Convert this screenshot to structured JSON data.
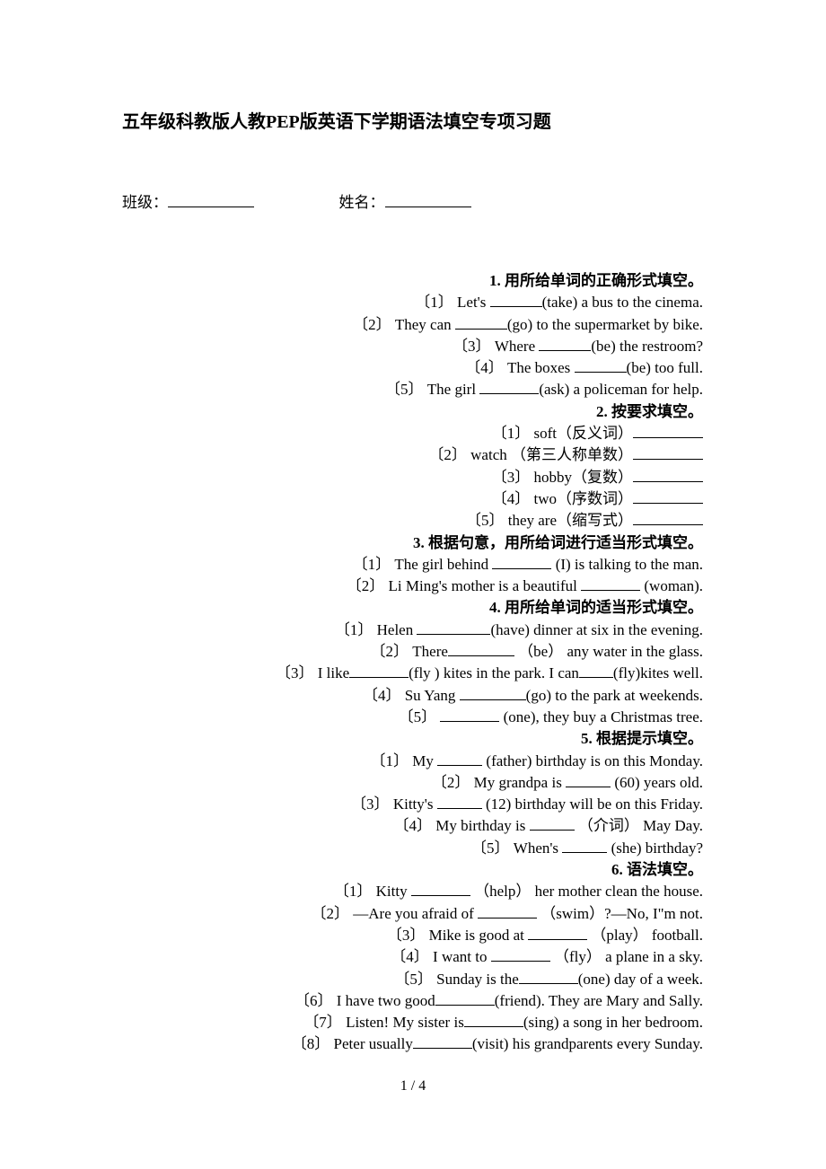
{
  "document": {
    "title": "五年级科教版人教PEP版英语下学期语法填空专项习题",
    "page_footer": "1 / 4",
    "fields": {
      "class_label": "班级：",
      "name_label": "姓名："
    }
  },
  "sections": [
    {
      "heading": "1. 用所给单词的正确形式填空。",
      "items": [
        {
          "num": "〔1〕",
          "before": "Let's ",
          "blank": "u-m",
          "after": "(take) a bus to the cinema."
        },
        {
          "num": "〔2〕",
          "before": "They can ",
          "blank": "u-m",
          "after": "(go) to the supermarket by bike."
        },
        {
          "num": "〔3〕",
          "before": "Where ",
          "blank": "u-m",
          "after": "(be) the restroom?"
        },
        {
          "num": "〔4〕",
          "before": "The boxes ",
          "blank": "u-m",
          "after": "(be) too full."
        },
        {
          "num": "〔5〕",
          "before": "The girl ",
          "blank": "u-l",
          "after": "(ask) a policeman for help."
        }
      ]
    },
    {
      "heading": "2. 按要求填空。",
      "items": [
        {
          "num": "〔1〕",
          "before": "soft（反义词）",
          "blank": "u-ans",
          "after": ""
        },
        {
          "num": "〔2〕",
          "before": "watch （第三人称单数）",
          "blank": "u-ans",
          "after": ""
        },
        {
          "num": "〔3〕",
          "before": "hobby（复数）",
          "blank": "u-ans",
          "after": ""
        },
        {
          "num": "〔4〕",
          "before": "two（序数词）",
          "blank": "u-ans",
          "after": ""
        },
        {
          "num": "〔5〕",
          "before": "they are（缩写式）",
          "blank": "u-ans",
          "after": ""
        }
      ]
    },
    {
      "heading": "3. 根据句意，用所给词进行适当形式填空。",
      "items": [
        {
          "num": "〔1〕",
          "before": "The girl behind ",
          "blank": "u-l",
          "after": " (I) is talking to the man."
        },
        {
          "num": "〔2〕",
          "before": "Li Ming's mother is a beautiful ",
          "blank": "u-l",
          "after": " (woman)."
        }
      ]
    },
    {
      "heading": "4. 用所给单词的适当形式填空。",
      "items": [
        {
          "num": "〔1〕",
          "before": "Helen ",
          "blank": "u-xxl",
          "after": "(have) dinner at six in the evening."
        },
        {
          "num": "〔2〕",
          "before": "There",
          "blank": "u-xl",
          "after": " （be） any water in the glass."
        },
        {
          "num": "〔3〕",
          "before": "I like",
          "blank": "u-l",
          "after": "(fly ) kites in the park. I can",
          "blank2": "u-xs",
          "after2": "(fly)kites well."
        },
        {
          "num": "〔4〕",
          "before": "Su Yang ",
          "blank": "u-xl",
          "after": "(go) to the park at weekends."
        },
        {
          "num": "〔5〕",
          "before": "",
          "blank": "u-l",
          "after": " (one), they buy a Christmas tree."
        }
      ]
    },
    {
      "heading": "5. 根据提示填空。",
      "items": [
        {
          "num": "〔1〕",
          "before": "My ",
          "blank": "u-s",
          "after": " (father) birthday is on this Monday."
        },
        {
          "num": "〔2〕",
          "before": "My grandpa is ",
          "blank": "u-s",
          "after": " (60) years old."
        },
        {
          "num": "〔3〕",
          "before": "Kitty's ",
          "blank": "u-s",
          "after": " (12) birthday will be on this Friday."
        },
        {
          "num": "〔4〕",
          "before": "My birthday is ",
          "blank": "u-s",
          "after": " （介词） May Day."
        },
        {
          "num": "〔5〕",
          "before": "When's ",
          "blank": "u-s",
          "after": " (she) birthday?"
        }
      ]
    },
    {
      "heading": "6. 语法填空。",
      "items": [
        {
          "num": "〔1〕",
          "before": "Kitty ",
          "blank": "u-l",
          "after": " （help） her mother clean the house."
        },
        {
          "num": "〔2〕",
          "before": "—Are you afraid of ",
          "blank": "u-l",
          "after": " （swim）?—No, I\"m not."
        },
        {
          "num": "〔3〕",
          "before": "Mike is good at ",
          "blank": "u-l",
          "after": " （play） football."
        },
        {
          "num": "〔4〕",
          "before": "I want to ",
          "blank": "u-l",
          "after": " （fly） a plane in a sky."
        },
        {
          "num": "〔5〕",
          "before": "Sunday is the",
          "blank": "u-l",
          "after": "(one) day of a week."
        },
        {
          "num": "〔6〕",
          "before": "I have two good",
          "blank": "u-l",
          "after": "(friend). They are Mary and Sally."
        },
        {
          "num": "〔7〕",
          "before": "Listen! My sister is",
          "blank": "u-l",
          "after": "(sing) a song in her bedroom."
        },
        {
          "num": "〔8〕",
          "before": "Peter usually",
          "blank": "u-l",
          "after": "(visit) his grandparents every Sunday."
        }
      ]
    }
  ]
}
